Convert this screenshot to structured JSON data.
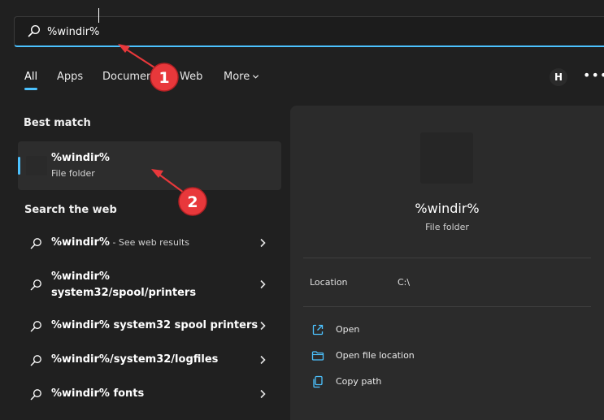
{
  "search": {
    "value": "%windir%"
  },
  "tabs": [
    {
      "label": "All"
    },
    {
      "label": "Apps"
    },
    {
      "label": "Documents"
    },
    {
      "label": "Web"
    },
    {
      "label": "More"
    }
  ],
  "header": {
    "avatar_initial": "H",
    "more_options": "•••"
  },
  "best_match": {
    "heading": "Best match",
    "title": "%windir%",
    "subtitle": "File folder"
  },
  "web": {
    "heading": "Search the web",
    "items": [
      {
        "text": "%windir%",
        "hint": " - See web results"
      },
      {
        "line1": "%windir%",
        "line2": "system32/spool/printers"
      },
      {
        "text": "%windir% system32 spool printers"
      },
      {
        "text": "%windir%/system32/logfiles"
      },
      {
        "text": "%windir% fonts"
      }
    ]
  },
  "preview": {
    "title": "%windir%",
    "subtitle": "File folder",
    "location_label": "Location",
    "location_value": "C:\\",
    "actions": [
      {
        "label": "Open",
        "icon": "open-external-icon"
      },
      {
        "label": "Open file location",
        "icon": "folder-icon"
      },
      {
        "label": "Copy path",
        "icon": "copy-icon"
      }
    ]
  },
  "annotations": [
    {
      "label": "1"
    },
    {
      "label": "2"
    }
  ],
  "colors": {
    "accent": "#4cc2ff",
    "callout": "#e8383b",
    "background": "#202020",
    "panel": "#2b2b2b"
  }
}
